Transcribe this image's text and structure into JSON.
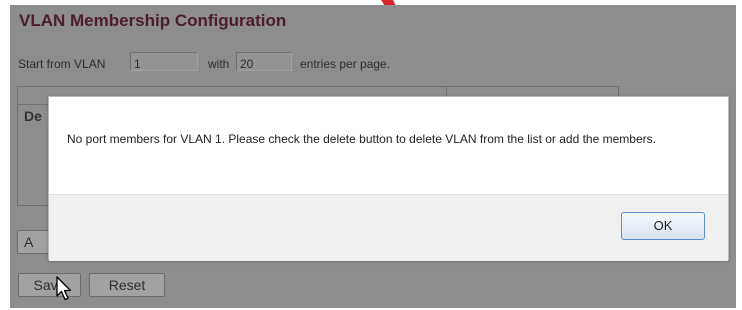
{
  "page": {
    "title": "VLAN Membership Configuration"
  },
  "paging": {
    "start_label": "Start from VLAN",
    "start_value": "1",
    "with_label": "with",
    "entries_value": "20",
    "entries_label": "entries per page."
  },
  "table": {
    "header_partial": "De"
  },
  "buttons": {
    "add_partial": "A",
    "save_label": "Save",
    "reset_label": "Reset"
  },
  "dialog": {
    "message": "No port members for VLAN 1. Please check the delete button to delete VLAN from the list or add the members.",
    "ok_label": "OK"
  },
  "icons": {
    "cursor": "mouse-pointer-icon",
    "annotation": "red-arrow-icon"
  },
  "colors": {
    "title": "#4c1d2b",
    "overlay_background": "#8d8d8d",
    "ok_border": "#5b8dc9",
    "annotation_arrow": "#d6262b"
  }
}
